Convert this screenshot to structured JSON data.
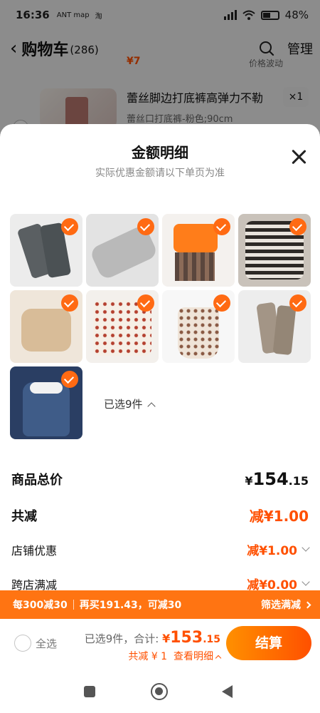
{
  "status_bar": {
    "time": "16:36",
    "app_icon_1": "ANT map",
    "app_icon_2": "淘",
    "battery": "48%"
  },
  "nav": {
    "title": "购物车",
    "count": "(286)",
    "manage": "管理"
  },
  "background": {
    "partial_price": "¥7",
    "price_note": "价格波动",
    "item_name": "蕾丝脚边打底裤高弹力不勒",
    "item_sku": "蕾丝口打底裤-粉色;90cm",
    "item_qty": "×1"
  },
  "sheet": {
    "title": "金额明细",
    "subtitle": "实际优惠金额请以下单页为准",
    "selected_text": "已选9件",
    "products": [
      {
        "name": "gray-leggings"
      },
      {
        "name": "light-gray-pants"
      },
      {
        "name": "orange-top-plaid-skirt-set"
      },
      {
        "name": "striped-sweater"
      },
      {
        "name": "beige-knit-sweater"
      },
      {
        "name": "floral-shirt"
      },
      {
        "name": "floral-dress"
      },
      {
        "name": "khaki-leggings"
      },
      {
        "name": "navy-collar-dress"
      }
    ]
  },
  "summary": {
    "total_label": "商品总价",
    "total_symbol": "¥",
    "total_int": "154",
    "total_dec": ".15",
    "saving_label": "共减",
    "saving_value": "减¥1.00",
    "shop_discount_label": "店铺优惠",
    "shop_discount_value": "减¥1.00",
    "cross_store_label": "跨店满减",
    "cross_store_value": "减¥0.00"
  },
  "promo": {
    "rule": "每300减30",
    "hint": "再买191.43，可减30",
    "filter": "筛选满减"
  },
  "checkout": {
    "select_all": "全选",
    "selected": "已选9件，",
    "sum_label": "合计: ",
    "sum_symbol": "¥",
    "sum_int": "153",
    "sum_dec": ".15",
    "saving_text": "共减 ¥ 1",
    "detail_link": "查看明细",
    "pay_button": "结算"
  },
  "colors": {
    "accent": "#ff5000",
    "promo_bar": "#ff7412",
    "check": "#ff6a13"
  }
}
